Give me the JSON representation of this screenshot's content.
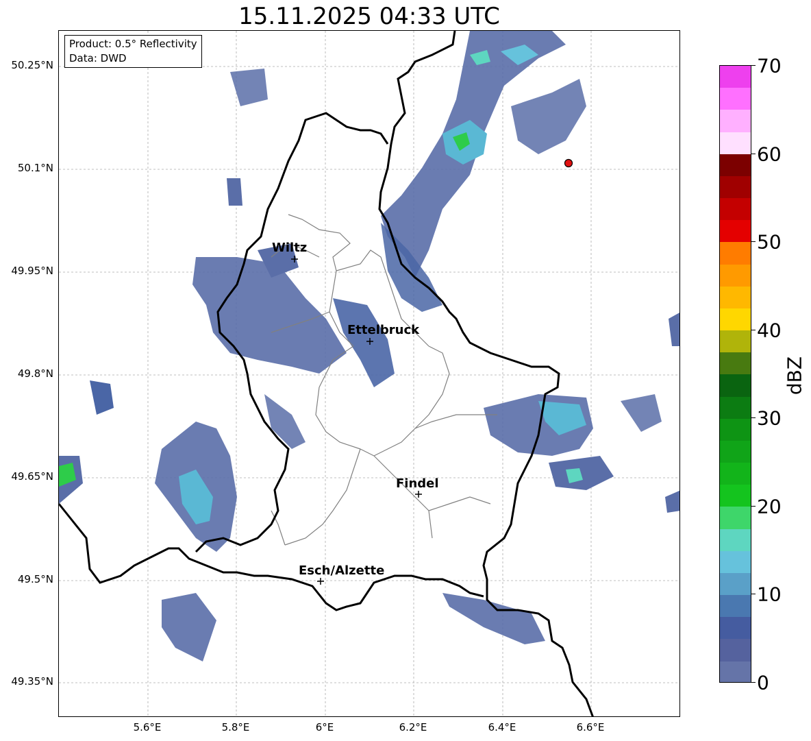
{
  "title": "15.11.2025 04:33 UTC",
  "info_box": {
    "product": "Product: 0.5° Reflectivity",
    "data": "Data: DWD"
  },
  "latitude_labels": [
    "50.25°N",
    "50.1°N",
    "49.95°N",
    "49.8°N",
    "49.65°N",
    "49.5°N",
    "49.35°N"
  ],
  "longitude_labels": [
    "5.6°E",
    "5.8°E",
    "6°E",
    "6.2°E",
    "6.4°E",
    "6.6°E"
  ],
  "cities": [
    {
      "name": "Wiltz"
    },
    {
      "name": "Ettelbruck"
    },
    {
      "name": "Findel"
    },
    {
      "name": "Esch/Alzette"
    }
  ],
  "colorbar": {
    "unit": "dBZ",
    "tick_labels": [
      "0",
      "10",
      "20",
      "30",
      "40",
      "50",
      "60",
      "70"
    ],
    "colors": [
      "#6574a8",
      "#55629e",
      "#455ca0",
      "#4a78b0",
      "#5aa0c8",
      "#66c2dc",
      "#5ed6c0",
      "#3ed66a",
      "#14c41e",
      "#12b41a",
      "#10a418",
      "#0e9414",
      "#0c7c12",
      "#0a6410",
      "#487a10",
      "#b0b40a",
      "#ffd700",
      "#ffb800",
      "#ff9a00",
      "#ff7c00",
      "#e40000",
      "#c40000",
      "#a00000",
      "#7c0000",
      "#ffe0ff",
      "#ffb0ff",
      "#ff70ff",
      "#ee40ee"
    ]
  },
  "marker_color": "#e01010"
}
